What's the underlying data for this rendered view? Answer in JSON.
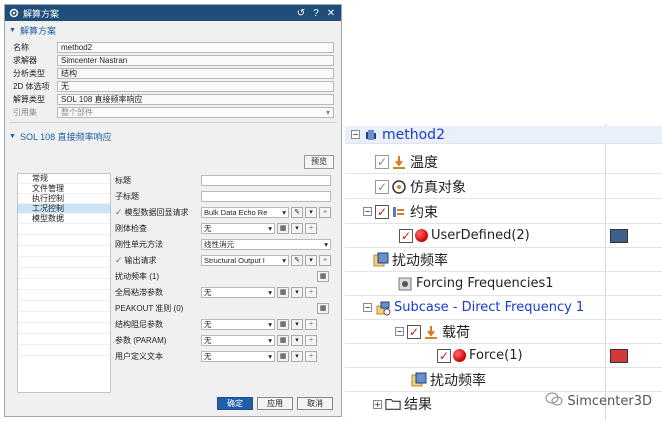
{
  "dialog": {
    "title": "解算方案",
    "colors": {
      "titlebar": "#1f4e79",
      "accent": "#1f5fa8"
    },
    "section1": {
      "header": "解算方案",
      "rows": [
        {
          "label": "名称",
          "value": "method2"
        },
        {
          "label": "求解器",
          "value": "Simcenter Nastran"
        },
        {
          "label": "分析类型",
          "value": "结构"
        },
        {
          "label": "2D 体选项",
          "value": "无"
        },
        {
          "label": "解算类型",
          "value": "SOL 108 直接频率响应"
        },
        {
          "label": "引用集",
          "value": "整个部件"
        }
      ]
    },
    "section2": {
      "header": "SOL 108 直接频率响应",
      "preview_label": "预览",
      "nav": [
        "常规",
        "文件管理",
        "执行控制",
        "工况控制",
        "模型数据"
      ],
      "nav_selected": "工况控制",
      "params": {
        "title": "标题",
        "subtitle": "子标题",
        "echo_label": "模型数据回显请求",
        "echo_value": "Bulk Data Echo Re",
        "rigid_label": "刚体检查",
        "rigid_value": "无",
        "rigid_method_label": "刚性单元方法",
        "rigid_method_value": "线性消元",
        "output_label": "输出请求",
        "output_value": "Structural Output I",
        "freq_label": "扰动频率 (1)",
        "damping_label": "全局粘滞参数",
        "damping_value": "无",
        "peakout_label": "PEAKOUT 准则 (0)",
        "struct_damp_label": "结构阻尼参数",
        "struct_damp_value": "无",
        "param_label": "参数 (PARAM)",
        "param_value": "无",
        "user_text_label": "用户定义文本",
        "user_text_value": "无"
      }
    },
    "footer": {
      "ok": "确定",
      "apply": "应用",
      "cancel": "取消"
    }
  },
  "tree": {
    "root": "method2",
    "items": {
      "temperature": "温度",
      "sim_object": "仿真对象",
      "constraint": "约束",
      "user_defined": "UserDefined(2)",
      "disturbance_freq": "扰动频率",
      "forcing_freq": "Forcing Frequencies1",
      "subcase": "Subcase - Direct Frequency 1",
      "loads": "载荷",
      "force": "Force(1)",
      "disturbance_freq_sub": "扰动频率",
      "results": "结果"
    },
    "swatch_colors": {
      "user_defined": "#3d5f8a",
      "force": "#d23a3a"
    }
  },
  "watermark": "Simcenter3D"
}
